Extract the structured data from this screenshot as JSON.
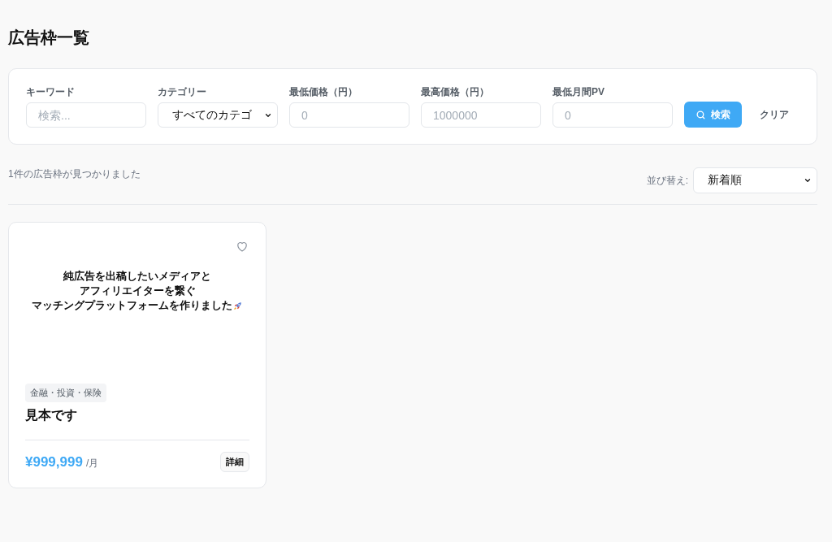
{
  "page": {
    "title": "広告枠一覧"
  },
  "filters": [
    {
      "kind": "text",
      "label": "キーワード",
      "placeholder": "検索..."
    },
    {
      "kind": "select",
      "label": "カテゴリー",
      "value": "すべてのカテゴ"
    },
    {
      "kind": "text",
      "label": "最低価格（円）",
      "placeholder": "0"
    },
    {
      "kind": "text",
      "label": "最高価格（円）",
      "placeholder": "1000000"
    },
    {
      "kind": "text",
      "label": "最低月間PV",
      "placeholder": "0"
    }
  ],
  "search_button": "検索",
  "clear_button": "クリア",
  "result_count": "1件の広告枠が見つかりました",
  "sort": {
    "label": "並び替え:",
    "value": "新着順"
  },
  "cards": [
    {
      "thumbnail_lines": [
        "純広告を出稿したいメディアと",
        "アフィリエイターを繋ぐ",
        "マッチングプラットフォームを作りました"
      ],
      "favorite": false,
      "category": "金融・投資・保険",
      "title": "見本です",
      "price": "¥999,999",
      "unit": "/月",
      "detail_button": "詳細"
    }
  ]
}
